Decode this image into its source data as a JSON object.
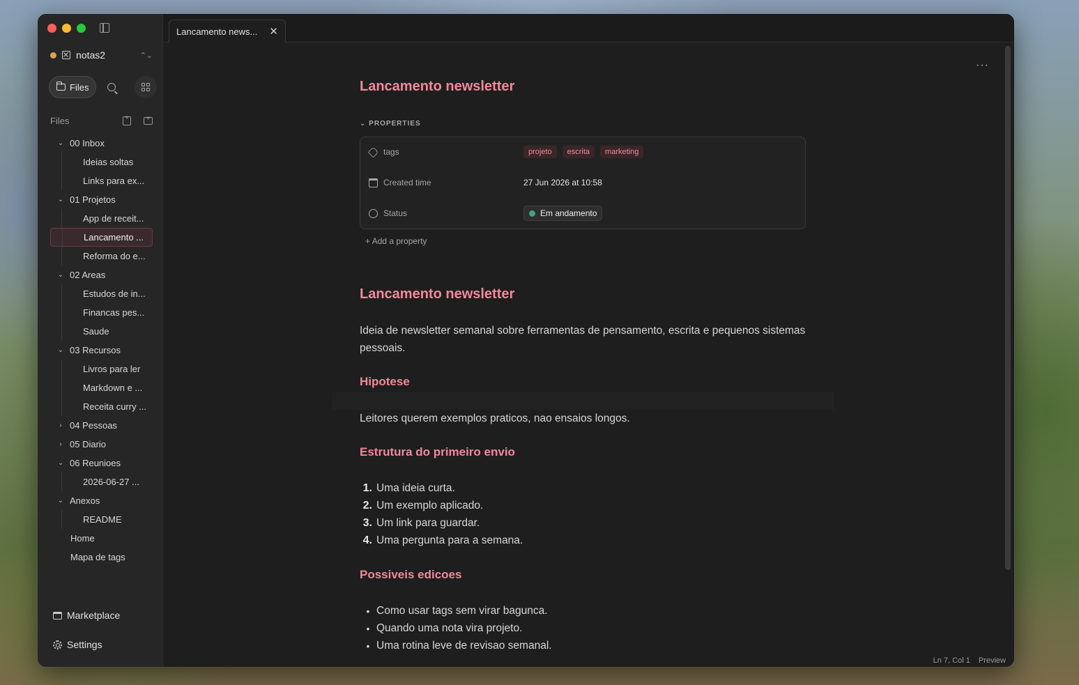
{
  "window": {
    "traffic_lights": [
      "close",
      "minimize",
      "zoom"
    ]
  },
  "vault": {
    "name": "notas2"
  },
  "nav": {
    "files_label": "Files"
  },
  "files_header": {
    "label": "Files"
  },
  "tree": [
    {
      "type": "folder",
      "label": "00 Inbox",
      "open": true
    },
    {
      "type": "file",
      "label": "Ideias soltas"
    },
    {
      "type": "file",
      "label": "Links para ex..."
    },
    {
      "type": "folder",
      "label": "01 Projetos",
      "open": true
    },
    {
      "type": "file",
      "label": "App de receit..."
    },
    {
      "type": "file",
      "label": "Lancamento ...",
      "active": true
    },
    {
      "type": "file",
      "label": "Reforma do e..."
    },
    {
      "type": "folder",
      "label": "02 Areas",
      "open": true
    },
    {
      "type": "file",
      "label": "Estudos de in..."
    },
    {
      "type": "file",
      "label": "Financas pes..."
    },
    {
      "type": "file",
      "label": "Saude"
    },
    {
      "type": "folder",
      "label": "03 Recursos",
      "open": true
    },
    {
      "type": "file",
      "label": "Livros para ler"
    },
    {
      "type": "file",
      "label": "Markdown e ..."
    },
    {
      "type": "file",
      "label": "Receita curry ..."
    },
    {
      "type": "folder",
      "label": "04 Pessoas",
      "open": false
    },
    {
      "type": "folder",
      "label": "05 Diario",
      "open": false
    },
    {
      "type": "folder",
      "label": "06 Reunioes",
      "open": true
    },
    {
      "type": "file",
      "label": "2026-06-27 ..."
    },
    {
      "type": "folder",
      "label": "Anexos",
      "open": true
    },
    {
      "type": "file",
      "label": "README"
    },
    {
      "type": "root",
      "label": "Home"
    },
    {
      "type": "root",
      "label": "Mapa de tags"
    }
  ],
  "sidebar_bottom": {
    "marketplace": "Marketplace",
    "settings": "Settings"
  },
  "tab": {
    "title": "Lancamento news..."
  },
  "doc": {
    "title": "Lancamento newsletter",
    "properties_header": "PROPERTIES",
    "properties": {
      "tags_key": "tags",
      "tags": [
        "projeto",
        "escrita",
        "marketing"
      ],
      "created_key": "Created time",
      "created_value": "27 Jun 2026 at 10:58",
      "status_key": "Status",
      "status_value": "Em andamento"
    },
    "add_property": "Add a property",
    "h1": "Lancamento newsletter",
    "intro": "Ideia de newsletter semanal sobre ferramentas de pensamento, escrita e pequenos sistemas pessoais.",
    "h_hipotese": "Hipotese",
    "hipotese_text": "Leitores querem exemplos praticos, nao ensaios longos.",
    "h_estrutura": "Estrutura do primeiro envio",
    "estrutura_items": [
      "Uma ideia curta.",
      "Um exemplo aplicado.",
      "Um link para guardar.",
      "Uma pergunta para a semana."
    ],
    "h_edicoes": "Possiveis edicoes",
    "edicoes_items": [
      "Como usar tags sem virar bagunca.",
      "Quando uma nota vira projeto.",
      "Uma rotina leve de revisao semanal."
    ]
  },
  "statusbar": {
    "position": "Ln 7, Col 1",
    "mode": "Preview"
  },
  "colors": {
    "accent": "#f08a9a",
    "status_dot": "#3fa67a",
    "vault_dot": "#e0a24a"
  }
}
